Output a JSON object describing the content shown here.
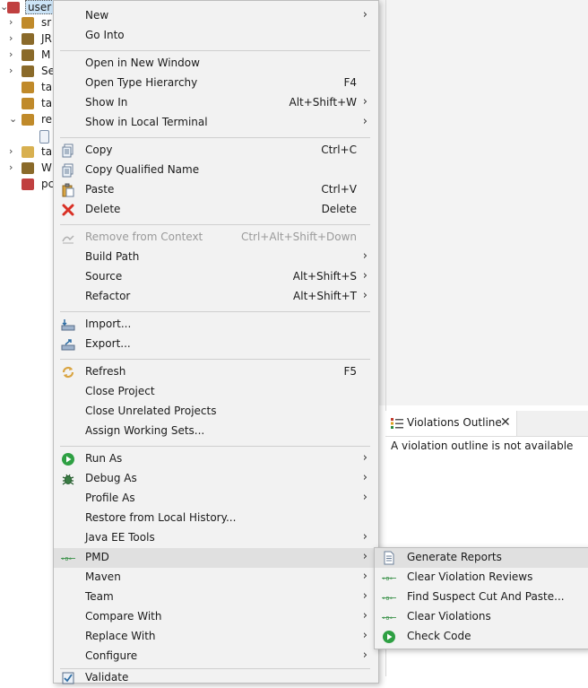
{
  "tree": {
    "items": [
      {
        "label": "user",
        "chev": "⌄",
        "icon_color": "#c04040"
      },
      {
        "label": "sr",
        "chev": "›",
        "icon_color": "#c08a2a"
      },
      {
        "label": "JR",
        "chev": "›",
        "icon_color": "#8a6a2a"
      },
      {
        "label": "M",
        "chev": "›",
        "icon_color": "#8a6a2a"
      },
      {
        "label": "Se",
        "chev": "›",
        "icon_color": "#8a6a2a"
      },
      {
        "label": "ta",
        "chev": "",
        "icon_color": "#c08a2a"
      },
      {
        "label": "ta",
        "chev": "",
        "icon_color": "#c08a2a"
      },
      {
        "label": "re",
        "chev": "⌄",
        "icon_color": "#c08a2a"
      },
      {
        "label": "",
        "chev": "",
        "icon_color": "#7a8ea8"
      },
      {
        "label": "ta",
        "chev": "›",
        "icon_color": "#d8b050"
      },
      {
        "label": "W",
        "chev": "›",
        "icon_color": "#8a6a2a"
      },
      {
        "label": "pc",
        "chev": "",
        "icon_color": "#c04040"
      }
    ]
  },
  "menu": {
    "items": [
      {
        "label": "New",
        "acc": "",
        "arrow": true,
        "icon": ""
      },
      {
        "label": "Go Into",
        "acc": "",
        "arrow": false,
        "icon": ""
      },
      {
        "label": "Open in New Window",
        "acc": "",
        "arrow": false,
        "icon": ""
      },
      {
        "label": "Open Type Hierarchy",
        "acc": "F4",
        "arrow": false,
        "icon": ""
      },
      {
        "label": "Show In",
        "acc": "Alt+Shift+W",
        "arrow": true,
        "icon": ""
      },
      {
        "label": "Show in Local Terminal",
        "acc": "",
        "arrow": true,
        "icon": ""
      },
      {
        "label": "Copy",
        "acc": "Ctrl+C",
        "arrow": false,
        "icon": "copy-icon"
      },
      {
        "label": "Copy Qualified Name",
        "acc": "",
        "arrow": false,
        "icon": "copy-qualified-icon"
      },
      {
        "label": "Paste",
        "acc": "Ctrl+V",
        "arrow": false,
        "icon": "paste-icon"
      },
      {
        "label": "Delete",
        "acc": "Delete",
        "arrow": false,
        "icon": "delete-icon"
      },
      {
        "label": "Remove from Context",
        "acc": "Ctrl+Alt+Shift+Down",
        "arrow": false,
        "icon": "remove-context-icon"
      },
      {
        "label": "Build Path",
        "acc": "",
        "arrow": true,
        "icon": ""
      },
      {
        "label": "Source",
        "acc": "Alt+Shift+S",
        "arrow": true,
        "icon": ""
      },
      {
        "label": "Refactor",
        "acc": "Alt+Shift+T",
        "arrow": true,
        "icon": ""
      },
      {
        "label": "Import...",
        "acc": "",
        "arrow": false,
        "icon": "import-icon"
      },
      {
        "label": "Export...",
        "acc": "",
        "arrow": false,
        "icon": "export-icon"
      },
      {
        "label": "Refresh",
        "acc": "F5",
        "arrow": false,
        "icon": "refresh-icon"
      },
      {
        "label": "Close Project",
        "acc": "",
        "arrow": false,
        "icon": ""
      },
      {
        "label": "Close Unrelated Projects",
        "acc": "",
        "arrow": false,
        "icon": ""
      },
      {
        "label": "Assign Working Sets...",
        "acc": "",
        "arrow": false,
        "icon": ""
      },
      {
        "label": "Run As",
        "acc": "",
        "arrow": true,
        "icon": "run-icon"
      },
      {
        "label": "Debug As",
        "acc": "",
        "arrow": true,
        "icon": "debug-icon"
      },
      {
        "label": "Profile As",
        "acc": "",
        "arrow": true,
        "icon": ""
      },
      {
        "label": "Restore from Local History...",
        "acc": "",
        "arrow": false,
        "icon": ""
      },
      {
        "label": "Java EE Tools",
        "acc": "",
        "arrow": true,
        "icon": ""
      },
      {
        "label": "PMD",
        "acc": "",
        "arrow": true,
        "icon": "pmd-icon"
      },
      {
        "label": "Maven",
        "acc": "",
        "arrow": true,
        "icon": ""
      },
      {
        "label": "Team",
        "acc": "",
        "arrow": true,
        "icon": ""
      },
      {
        "label": "Compare With",
        "acc": "",
        "arrow": true,
        "icon": ""
      },
      {
        "label": "Replace With",
        "acc": "",
        "arrow": true,
        "icon": ""
      },
      {
        "label": "Configure",
        "acc": "",
        "arrow": true,
        "icon": ""
      },
      {
        "label": "Validate",
        "acc": "",
        "arrow": false,
        "icon": "validate-icon"
      }
    ],
    "arrow_glyph": "›"
  },
  "pmd_submenu": {
    "items": [
      {
        "label": "Generate Reports",
        "icon": "report-icon"
      },
      {
        "label": "Clear Violation Reviews",
        "icon": "pmd-icon"
      },
      {
        "label": "Find Suspect Cut And Paste...",
        "icon": "pmd-icon"
      },
      {
        "label": "Clear Violations",
        "icon": "pmd-icon"
      },
      {
        "label": "Check Code",
        "icon": "check-code-icon"
      }
    ]
  },
  "violations_view": {
    "tab_label": "Violations Outline",
    "close_glyph": "✕",
    "message": "A violation outline is not available"
  },
  "colors": {
    "menu_bg": "#f2f2f2",
    "hover_bg": "#e0e0e0",
    "selection_bg": "#cce4f7",
    "disabled_text": "#9a9a9a",
    "pmd_green": "#2e8b3e"
  }
}
